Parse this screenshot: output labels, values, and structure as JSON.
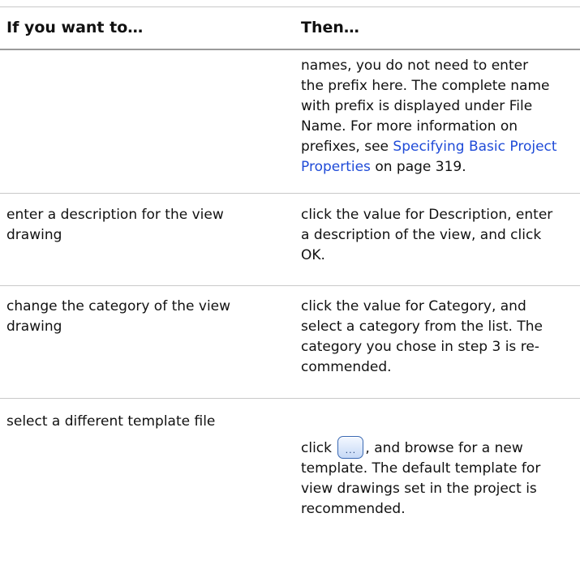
{
  "table": {
    "header": {
      "col1": "If you want to…",
      "col2": "Then…"
    },
    "rows": [
      {
        "action": "",
        "result_lines": [
          "names, you do not need to enter",
          "the prefix here. The complete name",
          "with prefix is displayed under File",
          "Name. For more information on",
          "prefixes, see "
        ],
        "link_text": "Specifying Basic Project Properties",
        "link_text_line1": "Specifying Basic Project",
        "link_text_line2": "Properties",
        "after_link": " on page 319."
      },
      {
        "action_lines": [
          "enter a description for the view",
          "drawing"
        ],
        "result_lines": [
          "click the value for Description, enter",
          "a description of the view, and click",
          "OK."
        ]
      },
      {
        "action_lines": [
          "change the category of the view",
          "drawing"
        ],
        "result_lines": [
          "click the value for Category, and",
          "select a category from the list. The",
          "category you chose in step 3 is re-",
          "commended."
        ]
      },
      {
        "action_lines": [
          "select a different template file"
        ],
        "result_before_icon": "click ",
        "icon_glyph": "...",
        "result_after_icon": ", and browse for a new",
        "result_lines": [
          "template. The default template for",
          "view drawings set in the project is",
          "recommended."
        ]
      }
    ]
  }
}
